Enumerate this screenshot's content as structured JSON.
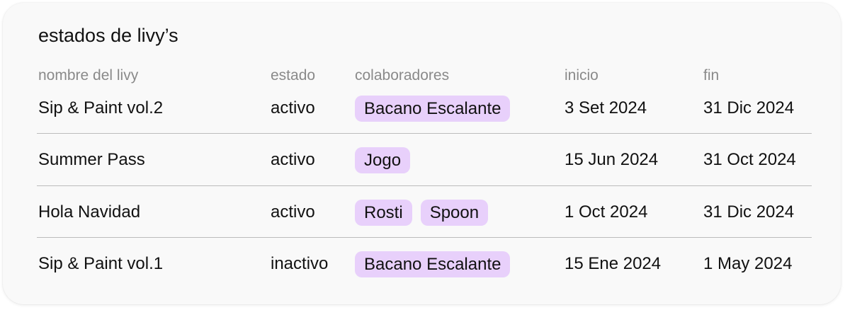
{
  "card": {
    "title": "estados de livy’s"
  },
  "table": {
    "headers": {
      "name": "nombre del livy",
      "estado": "estado",
      "colaboradores": "colaboradores",
      "inicio": "inicio",
      "fin": "fin"
    },
    "rows": [
      {
        "name": "Sip & Paint vol.2",
        "estado": "activo",
        "colaboradores": [
          "Bacano Escalante"
        ],
        "inicio": "3 Set 2024",
        "fin": "31 Dic 2024"
      },
      {
        "name": "Summer Pass",
        "estado": "activo",
        "colaboradores": [
          "Jogo"
        ],
        "inicio": "15 Jun 2024",
        "fin": "31 Oct 2024"
      },
      {
        "name": "Hola Navidad",
        "estado": "activo",
        "colaboradores": [
          "Rosti",
          "Spoon"
        ],
        "inicio": "1 Oct 2024",
        "fin": "31 Dic 2024"
      },
      {
        "name": "Sip & Paint vol.1",
        "estado": "inactivo",
        "colaboradores": [
          "Bacano Escalante"
        ],
        "inicio": "15 Ene 2024",
        "fin": "1 May 2024"
      }
    ]
  },
  "colors": {
    "pill_background": "#e8d0fb",
    "header_text": "#8a8a8a",
    "divider": "#bcbcbc",
    "card_background": "#f9f9f9"
  }
}
